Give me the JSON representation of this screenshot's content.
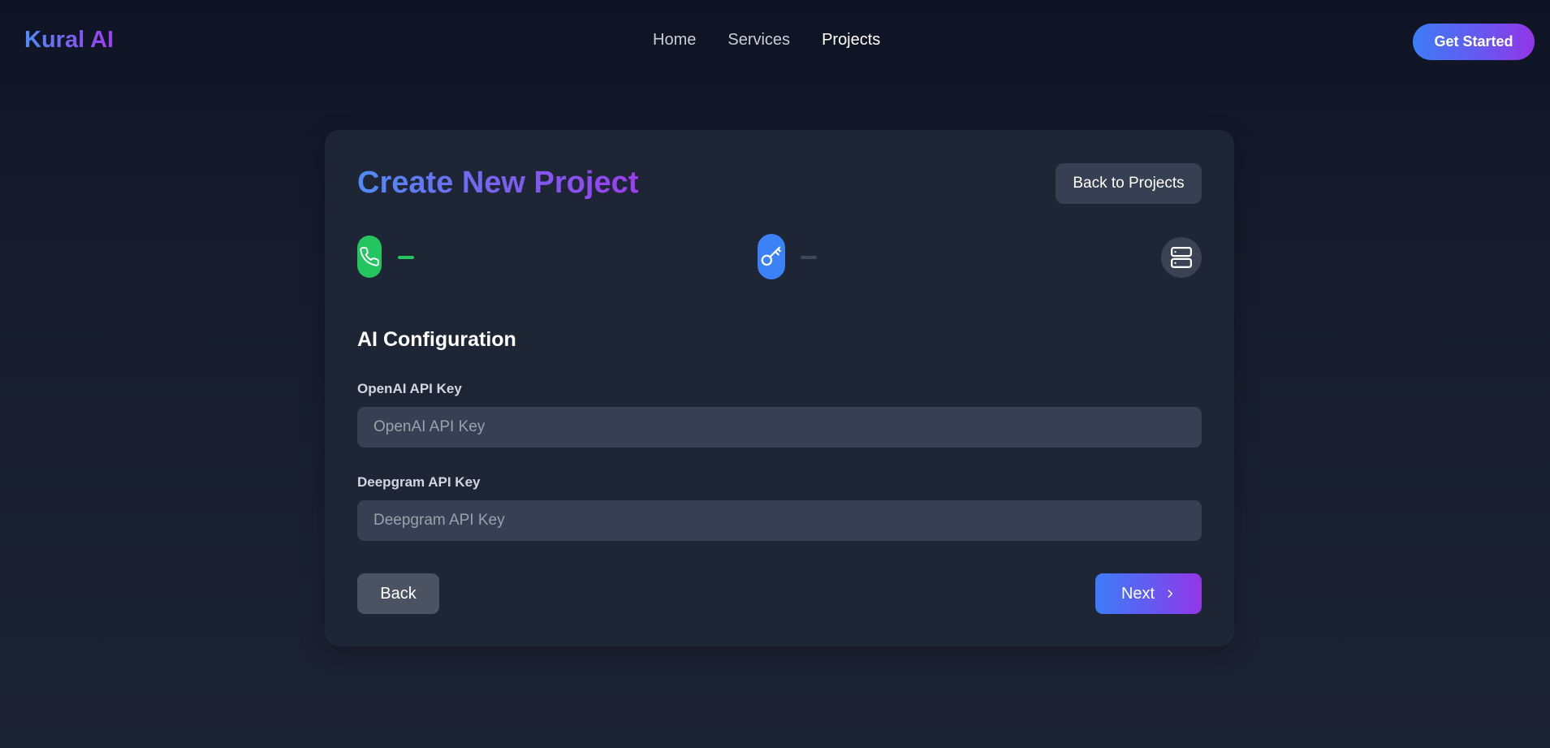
{
  "nav": {
    "logo": "Kural AI",
    "links": [
      {
        "label": "Home",
        "active": false
      },
      {
        "label": "Services",
        "active": false
      },
      {
        "label": "Projects",
        "active": true
      }
    ],
    "cta_label": "Get Started"
  },
  "card": {
    "title": "Create New Project",
    "back_to_projects_label": "Back to Projects",
    "stepper": {
      "steps": [
        {
          "icon": "phone-icon",
          "state": "completed",
          "color": "#22c55e"
        },
        {
          "icon": "key-icon",
          "state": "current",
          "color": "#3b82f6"
        },
        {
          "icon": "server-icon",
          "state": "upcoming",
          "color": "#3a4253"
        }
      ]
    },
    "section_title": "AI Configuration",
    "fields": [
      {
        "label": "OpenAI API Key",
        "value": "",
        "placeholder": "OpenAI API Key"
      },
      {
        "label": "Deepgram API Key",
        "value": "",
        "placeholder": "Deepgram API Key"
      }
    ],
    "back_label": "Back",
    "next_label": "Next",
    "next_icon": "chevron-right-icon"
  },
  "colors": {
    "accent_blue": "#3b82f6",
    "accent_purple": "#9333ea",
    "success_green": "#22c55e",
    "card_bg": "#1e2636",
    "input_bg": "#374052"
  }
}
